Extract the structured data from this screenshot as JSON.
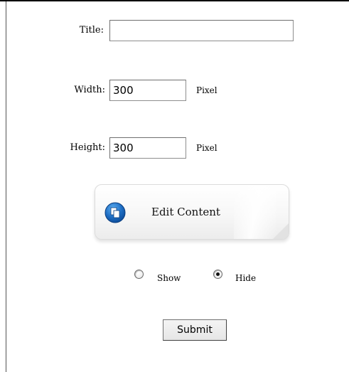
{
  "form": {
    "title": {
      "label": "Title:",
      "value": ""
    },
    "width": {
      "label": "Width:",
      "value": "300",
      "unit": "Pixel"
    },
    "height": {
      "label": "Height:",
      "value": "300",
      "unit": "Pixel"
    }
  },
  "edit_content": {
    "label": "Edit Content",
    "icon": "edit-content-icon"
  },
  "visibility": {
    "options": [
      {
        "label": "Show",
        "selected": false
      },
      {
        "label": "Hide",
        "selected": true
      }
    ]
  },
  "submit": {
    "label": "Submit"
  },
  "colors": {
    "icon_blue": "#1f6fc5",
    "button_border": "#dcdcdc"
  }
}
